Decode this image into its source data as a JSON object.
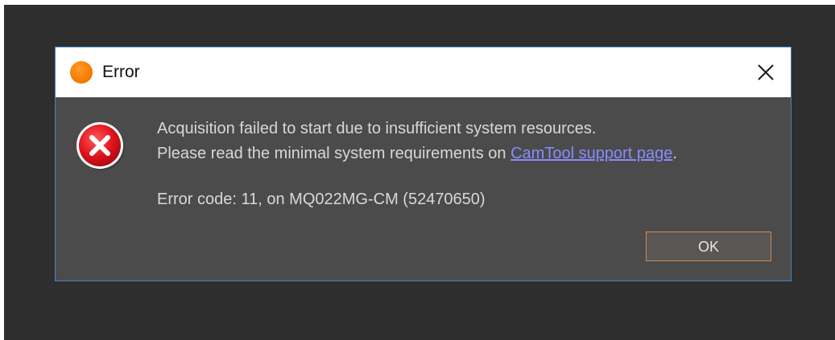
{
  "dialog": {
    "title": "Error",
    "message": {
      "line1": "Acquisition failed to start due to insufficient system resources.",
      "line2_prefix": "Please read the minimal system requirements on ",
      "link_text": "CamTool support page",
      "line2_suffix": ".",
      "error_code": "Error code: 11, on MQ022MG-CM (52470650)"
    },
    "ok_label": "OK",
    "icons": {
      "app": "app-logo-icon",
      "close": "close-icon",
      "error": "error-icon"
    },
    "colors": {
      "backdrop": "#2e2e2e",
      "dialog_body": "#4b4b4b",
      "border": "#3f86c8",
      "link": "#8a8aff",
      "error_red": "#e0121b",
      "app_orange": "#f57c00",
      "ok_border": "#c98c56"
    }
  }
}
